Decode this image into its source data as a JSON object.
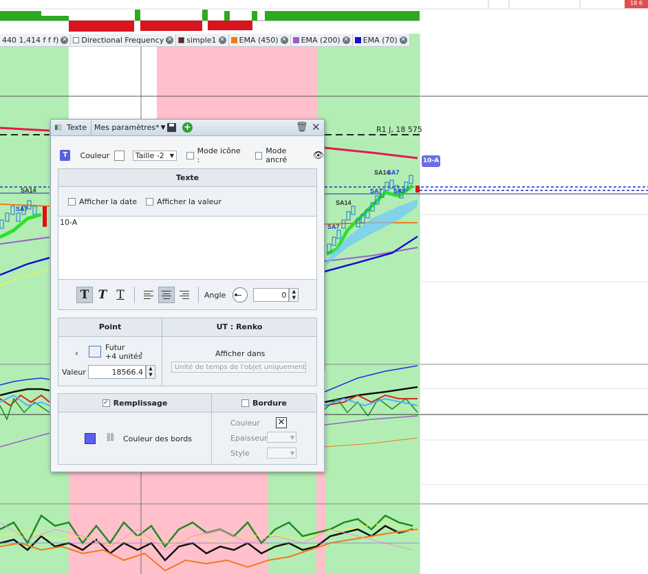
{
  "chart": {
    "indicator_tags": [
      {
        "label": "440 1,414 f f f)",
        "swatch": "none"
      },
      {
        "label": "Directional Frequency",
        "swatch": "#ffffff"
      },
      {
        "label": "simple1",
        "swatch": "#8a1a1a"
      },
      {
        "label": "EMA (450)",
        "swatch": "#f07a1a"
      },
      {
        "label": "EMA (200)",
        "swatch": "#9a5ec8"
      },
      {
        "label": "EMA (70)",
        "swatch": "#1010d0"
      }
    ],
    "r1_label": "R1 J, 18 575",
    "object_label": "10-A",
    "annotations": [
      "SA14",
      "SA7",
      "SA14",
      "SA7",
      "SA14",
      "SA7",
      "SA14",
      "SA7"
    ],
    "topright_badge": "18 6",
    "colors": {
      "green_zone": "#b2eeb3",
      "pink_zone": "#ffc0cb",
      "ema450": "#f07a1a",
      "ema200": "#9a5ec8",
      "ema70": "#1010d0",
      "resistance": "#e8174f"
    }
  },
  "dialog": {
    "title_tab": "Texte",
    "preset": "Mes paramètres*",
    "icons": [
      "save-icon",
      "add-icon",
      "trash-icon",
      "close-icon"
    ],
    "row1": {
      "text_type_icon": "T",
      "couleur_label": "Couleur",
      "taille_value": "Taille -2",
      "mode_icone_label": "Mode icône :",
      "mode_ancre_label": "Mode ancré"
    },
    "texte_section": {
      "header": "Texte",
      "show_date_label": "Afficher la date",
      "show_value_label": "Afficher la valeur",
      "text_value": "10-A",
      "angle_label": "Angle",
      "angle_value": "0",
      "format_buttons": [
        "T",
        "T",
        "T"
      ]
    },
    "point_section": {
      "header": "Point",
      "future_label": "Futur",
      "units_label": "+4 unités",
      "value_label": "Valeur",
      "value": "18566.4"
    },
    "ut_section": {
      "header": "UT : Renko",
      "show_in_label": "Afficher dans",
      "show_in_value": "Unité de temps de l'objet uniquement"
    },
    "fill_section": {
      "header": "Remplissage",
      "checked": true,
      "edge_color_label": "Couleur des bords"
    },
    "border_section": {
      "header": "Bordure",
      "checked": false,
      "color_label": "Couleur",
      "thickness_label": "Epaisseur",
      "style_label": "Style"
    }
  }
}
